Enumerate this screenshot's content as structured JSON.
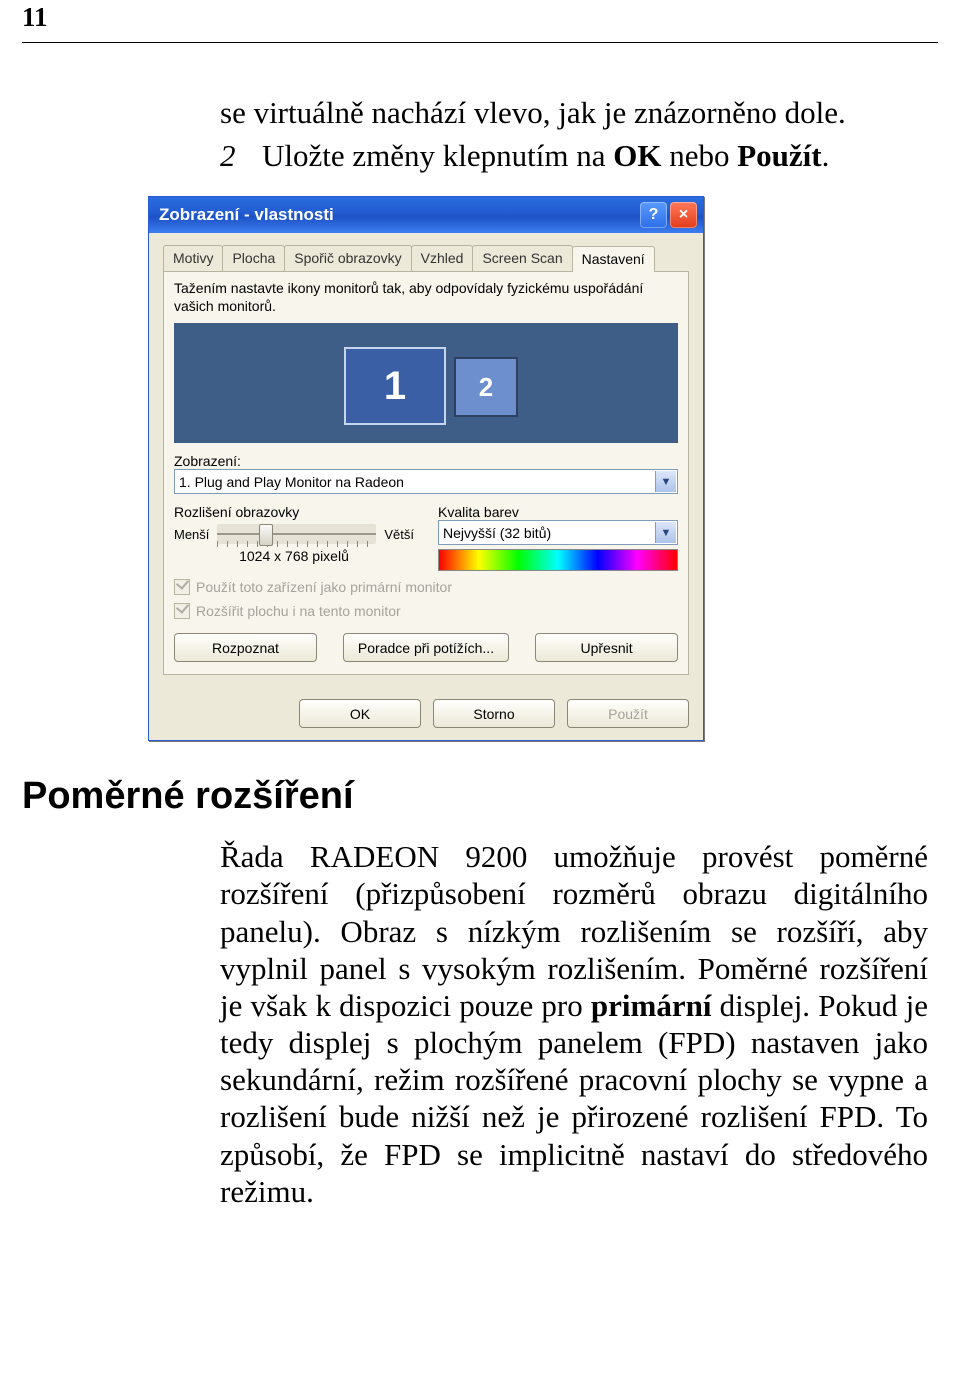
{
  "page_number": "11",
  "intro": {
    "line1": "se virtuálně nachází vlevo, jak je znázorněno dole.",
    "step_number": "2",
    "step_text_before": "Uložte změny klepnutím na ",
    "ok": "OK",
    "mid": " nebo ",
    "apply": "Použít",
    "end": "."
  },
  "dialog": {
    "title": "Zobrazení - vlastnosti",
    "tabs": [
      "Motivy",
      "Plocha",
      "Spořič obrazovky",
      "Vzhled",
      "Screen Scan",
      "Nastavení"
    ],
    "hint": "Tažením nastavte ikony monitorů tak, aby odpovídaly fyzickému uspořádání vašich monitorů.",
    "monitor1": "1",
    "monitor2": "2",
    "display_label": "Zobrazení:",
    "display_value": "1. Plug and Play Monitor na Radeon",
    "res_label": "Rozlišení obrazovky",
    "res_lo": "Menší",
    "res_hi": "Větší",
    "res_value": "1024 x 768 pixelů",
    "color_label": "Kvalita barev",
    "color_value": "Nejvyšší (32 bitů)",
    "chk1": "Použít toto zařízení jako primární monitor",
    "chk2": "Rozšířit plochu i na tento monitor",
    "btn_identify": "Rozpoznat",
    "btn_troubleshoot": "Poradce při potížích...",
    "btn_advanced": "Upřesnit",
    "btn_ok": "OK",
    "btn_cancel": "Storno",
    "btn_apply": "Použít"
  },
  "heading": "Poměrné rozšíření",
  "body": {
    "t": "Řada RADEON 9200 umožňuje provést poměrné rozšíření (přizpůsobení rozměrů obrazu digitálního panelu). Obraz s nízkým rozlišením se rozšíří, aby vyplnil panel s vysokým rozlišením. Poměrné rozšíření je však k dispozici pouze pro ",
    "bold1": "primární",
    "t2": " displej. Pokud je tedy displej s plochým panelem (FPD) nastaven jako sekundární, režim rozšířené pracovní plochy se vypne a rozlišení bude nižší než je přirozené rozlišení FPD. To způsobí, že FPD se implicitně nastaví do středového režimu."
  }
}
